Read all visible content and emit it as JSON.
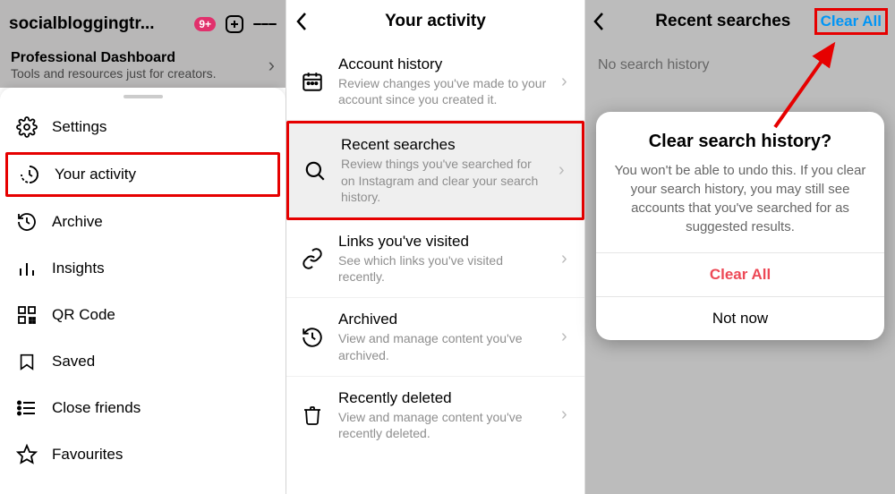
{
  "panel1": {
    "username": "socialbloggingtr...",
    "badge": "9+",
    "dash_title": "Professional Dashboard",
    "dash_subtitle": "Tools and resources just for creators.",
    "menu": [
      {
        "label": "Settings"
      },
      {
        "label": "Your activity"
      },
      {
        "label": "Archive"
      },
      {
        "label": "Insights"
      },
      {
        "label": "QR Code"
      },
      {
        "label": "Saved"
      },
      {
        "label": "Close friends"
      },
      {
        "label": "Favourites"
      }
    ]
  },
  "panel2": {
    "title": "Your activity",
    "items": [
      {
        "title": "Account history",
        "desc": "Review changes you've made to your account since you created it."
      },
      {
        "title": "Recent searches",
        "desc": "Review things you've searched for on Instagram and clear your search history."
      },
      {
        "title": "Links you've visited",
        "desc": "See which links you've visited recently."
      },
      {
        "title": "Archived",
        "desc": "View and manage content you've archived."
      },
      {
        "title": "Recently deleted",
        "desc": "View and manage content you've recently deleted."
      }
    ]
  },
  "panel3": {
    "title": "Recent searches",
    "clear": "Clear All",
    "empty": "No search history",
    "modal": {
      "title": "Clear search history?",
      "desc": "You won't be able to undo this. If you clear your search history, you may still see accounts that you've searched for as suggested results.",
      "confirm": "Clear All",
      "cancel": "Not now"
    }
  }
}
